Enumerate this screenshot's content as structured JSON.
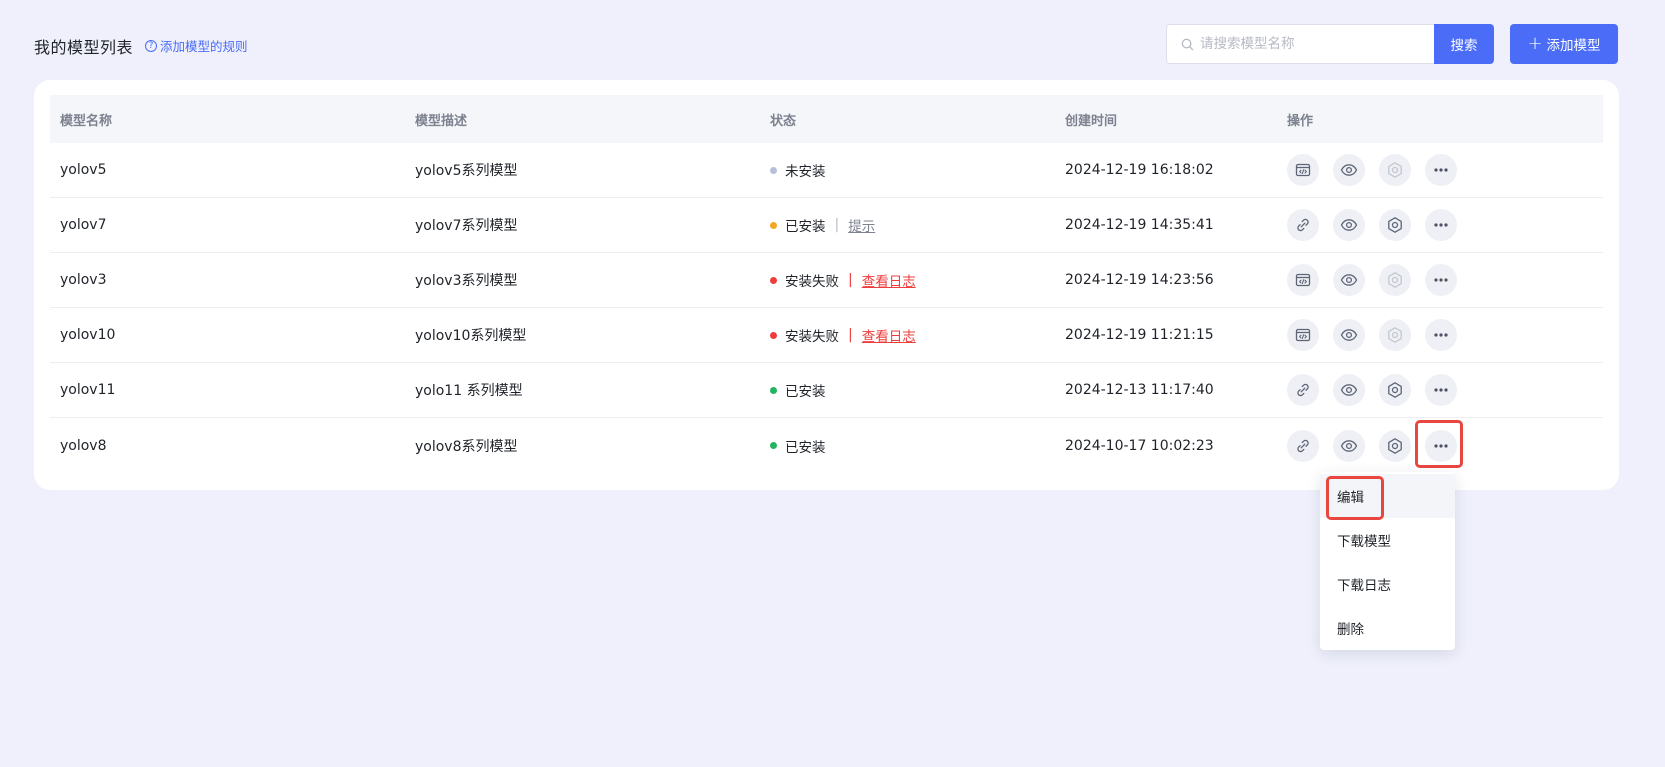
{
  "header": {
    "title": "我的模型列表",
    "rule_link": "添加模型的规则",
    "search_placeholder": "请搜索模型名称",
    "search_button": "搜索",
    "add_button": "添加模型"
  },
  "table": {
    "columns": [
      "模型名称",
      "模型描述",
      "状态",
      "创建时间",
      "操作"
    ],
    "rows": [
      {
        "name": "yolov5",
        "desc": "yolov5系列模型",
        "status": "未安装",
        "status_color": "#b6bfd6",
        "link": "",
        "time": "2024-12-19 16:18:02",
        "op1_icon": "code-window-icon",
        "config_enabled": false
      },
      {
        "name": "yolov7",
        "desc": "yolov7系列模型",
        "status": "已安装",
        "status_color": "#f5a623",
        "link": "提示",
        "time": "2024-12-19 14:35:41",
        "op1_icon": "unlink-icon",
        "config_enabled": true
      },
      {
        "name": "yolov3",
        "desc": "yolov3系列模型",
        "status": "安装失败",
        "status_color": "#ef3d3d",
        "link": "查看日志",
        "time": "2024-12-19 14:23:56",
        "op1_icon": "code-window-icon",
        "config_enabled": false
      },
      {
        "name": "yolov10",
        "desc": "yolov10系列模型",
        "status": "安装失败",
        "status_color": "#ef3d3d",
        "link": "查看日志",
        "time": "2024-12-19 11:21:15",
        "op1_icon": "code-window-icon",
        "config_enabled": false
      },
      {
        "name": "yolov11",
        "desc": "yolo11 系列模型",
        "status": "已安装",
        "status_color": "#22b35e",
        "link": "",
        "time": "2024-12-13 11:17:40",
        "op1_icon": "unlink-icon",
        "config_enabled": true
      },
      {
        "name": "yolov8",
        "desc": "yolov8系列模型",
        "status": "已安装",
        "status_color": "#22b35e",
        "link": "",
        "time": "2024-10-17 10:02:23",
        "op1_icon": "unlink-icon",
        "config_enabled": true
      }
    ]
  },
  "dropdown": {
    "items": [
      "编辑",
      "下载模型",
      "下载日志",
      "删除"
    ]
  },
  "colors": {
    "accent": "#4a6cf7",
    "highlight": "#e8473f",
    "background": "#eff0fb"
  }
}
